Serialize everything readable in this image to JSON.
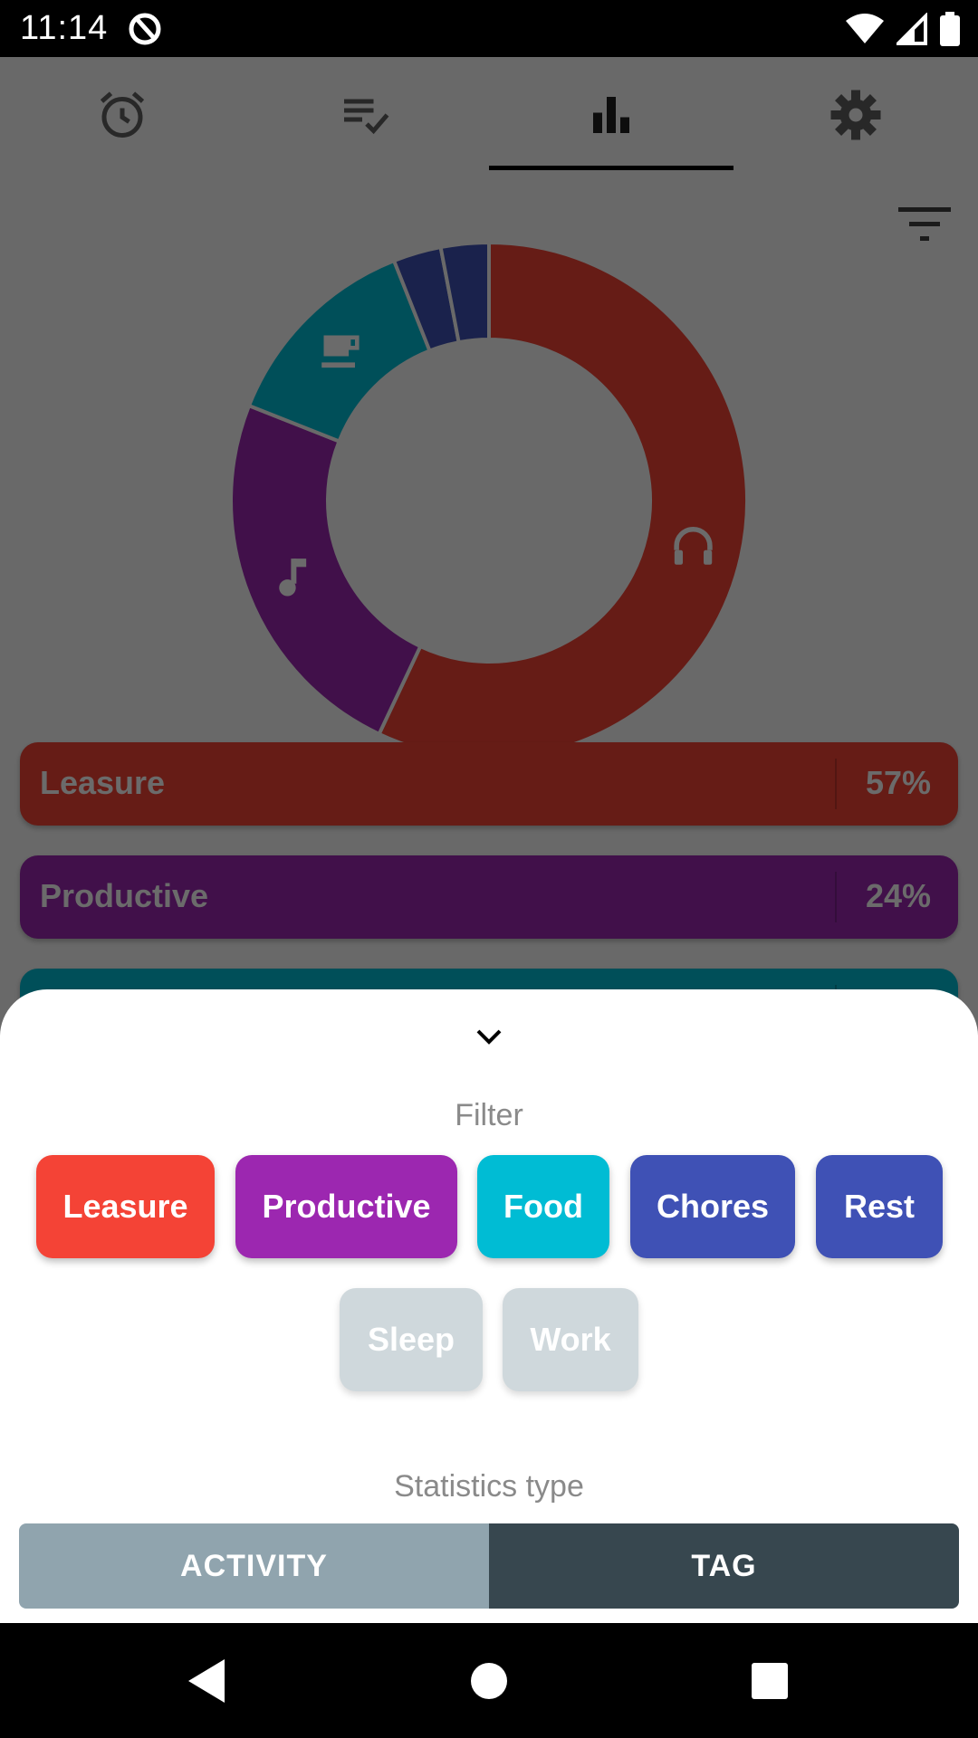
{
  "status_bar": {
    "time": "11:14"
  },
  "tabs": [
    {
      "icon": "alarm-clock-icon"
    },
    {
      "icon": "checklist-icon"
    },
    {
      "icon": "bar-chart-icon",
      "selected": true
    },
    {
      "icon": "gear-icon"
    }
  ],
  "chart_data": {
    "type": "pie",
    "donut": true,
    "slices": [
      {
        "label": "Leasure",
        "value": 57,
        "color": "#f44336",
        "icon": "headphones-icon"
      },
      {
        "label": "Productive",
        "value": 24,
        "color": "#9c27b0",
        "icon": "music-note-icon"
      },
      {
        "label": "Food",
        "value": 13,
        "color": "#00bcd4",
        "icon": "coffee-cup-icon"
      },
      {
        "label": "Chores",
        "value": 3,
        "color": "#3f51b5"
      },
      {
        "label": "Rest",
        "value": 3,
        "color": "#3f51b5"
      }
    ]
  },
  "stat_list": [
    {
      "name": "Leasure",
      "percent": "57%",
      "color": "#f44336"
    },
    {
      "name": "Productive",
      "percent": "24%",
      "color": "#9c27b0"
    },
    {
      "name": "",
      "percent": "",
      "color": "#00bcd4"
    }
  ],
  "sheet": {
    "filter_title": "Filter",
    "chips": [
      {
        "label": "Leasure",
        "color": "#f44336",
        "active": true
      },
      {
        "label": "Productive",
        "color": "#9c27b0",
        "active": true
      },
      {
        "label": "Food",
        "color": "#00bcd4",
        "active": true
      },
      {
        "label": "Chores",
        "color": "#3f51b5",
        "active": true
      },
      {
        "label": "Rest",
        "color": "#3f51b5",
        "active": true
      },
      {
        "label": "Sleep",
        "color": "#cfd8dc",
        "active": false
      },
      {
        "label": "Work",
        "color": "#cfd8dc",
        "active": false
      }
    ],
    "stats_type_title": "Statistics type",
    "stats_type_options": [
      {
        "label": "ACTIVITY",
        "selected": false,
        "color": "#90a4ae"
      },
      {
        "label": "TAG",
        "selected": true,
        "color": "#37474f"
      }
    ]
  }
}
